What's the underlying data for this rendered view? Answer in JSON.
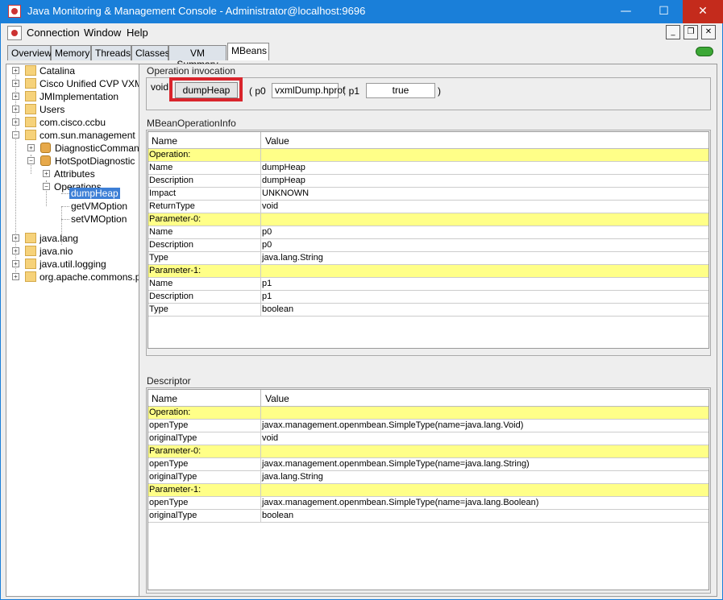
{
  "window": {
    "title": "Java Monitoring & Management Console - Administrator@localhost:9696",
    "min_glyph": "—",
    "max_glyph": "☐",
    "close_glyph": "✕"
  },
  "menu": {
    "items": [
      "Connection",
      "Window",
      "Help"
    ],
    "controls": [
      "_",
      "❐",
      "✕"
    ]
  },
  "tabs": [
    "Overview",
    "Memory",
    "Threads",
    "Classes",
    "VM Summary",
    "MBeans"
  ],
  "active_tab": "MBeans",
  "tree": {
    "items": [
      {
        "label": "Catalina"
      },
      {
        "label": "Cisco Unified CVP VXML S"
      },
      {
        "label": "JMImplementation"
      },
      {
        "label": "Users"
      },
      {
        "label": "com.cisco.ccbu"
      },
      {
        "label": "com.sun.management"
      },
      {
        "label": "DiagnosticCommand"
      },
      {
        "label": "HotSpotDiagnostic"
      },
      {
        "label": "Attributes"
      },
      {
        "label": "Operations"
      },
      {
        "label": "dumpHeap"
      },
      {
        "label": "getVMOption"
      },
      {
        "label": "setVMOption"
      },
      {
        "label": "java.lang"
      },
      {
        "label": "java.nio"
      },
      {
        "label": "java.util.logging"
      },
      {
        "label": "org.apache.commons.po"
      }
    ],
    "selected": "dumpHeap"
  },
  "invocation": {
    "title": "Operation invocation",
    "return_type": "void",
    "button_label": "dumpHeap",
    "open_paren": "( p0",
    "p0_value": "vxmlDump.hprof",
    "sep": ", p1",
    "p1_value": "true",
    "close_paren": ")"
  },
  "operation_info": {
    "title": "MBeanOperationInfo",
    "headers": [
      "Name",
      "Value"
    ],
    "rows": [
      {
        "name": "Operation:",
        "value": "",
        "group": true
      },
      {
        "name": "Name",
        "value": "dumpHeap"
      },
      {
        "name": "Description",
        "value": "dumpHeap"
      },
      {
        "name": "Impact",
        "value": "UNKNOWN"
      },
      {
        "name": "ReturnType",
        "value": "void"
      },
      {
        "name": "Parameter-0:",
        "value": "",
        "group": true
      },
      {
        "name": "Name",
        "value": "p0"
      },
      {
        "name": "Description",
        "value": "p0"
      },
      {
        "name": "Type",
        "value": "java.lang.String"
      },
      {
        "name": "Parameter-1:",
        "value": "",
        "group": true
      },
      {
        "name": "Name",
        "value": "p1"
      },
      {
        "name": "Description",
        "value": "p1"
      },
      {
        "name": "Type",
        "value": "boolean"
      }
    ]
  },
  "descriptor": {
    "title": "Descriptor",
    "headers": [
      "Name",
      "Value"
    ],
    "rows": [
      {
        "name": "Operation:",
        "value": "",
        "group": true
      },
      {
        "name": "openType",
        "value": "javax.management.openmbean.SimpleType(name=java.lang.Void)"
      },
      {
        "name": "originalType",
        "value": "void"
      },
      {
        "name": "Parameter-0:",
        "value": "",
        "group": true
      },
      {
        "name": "openType",
        "value": "javax.management.openmbean.SimpleType(name=java.lang.String)"
      },
      {
        "name": "originalType",
        "value": "java.lang.String"
      },
      {
        "name": "Parameter-1:",
        "value": "",
        "group": true
      },
      {
        "name": "openType",
        "value": "javax.management.openmbean.SimpleType(name=java.lang.Boolean)"
      },
      {
        "name": "originalType",
        "value": "boolean"
      }
    ]
  },
  "colors": {
    "titlebar": "#1a7fd9",
    "highlight_frame": "#d9252c",
    "group_row": "#ffff88",
    "selection": "#3d7fd6"
  }
}
